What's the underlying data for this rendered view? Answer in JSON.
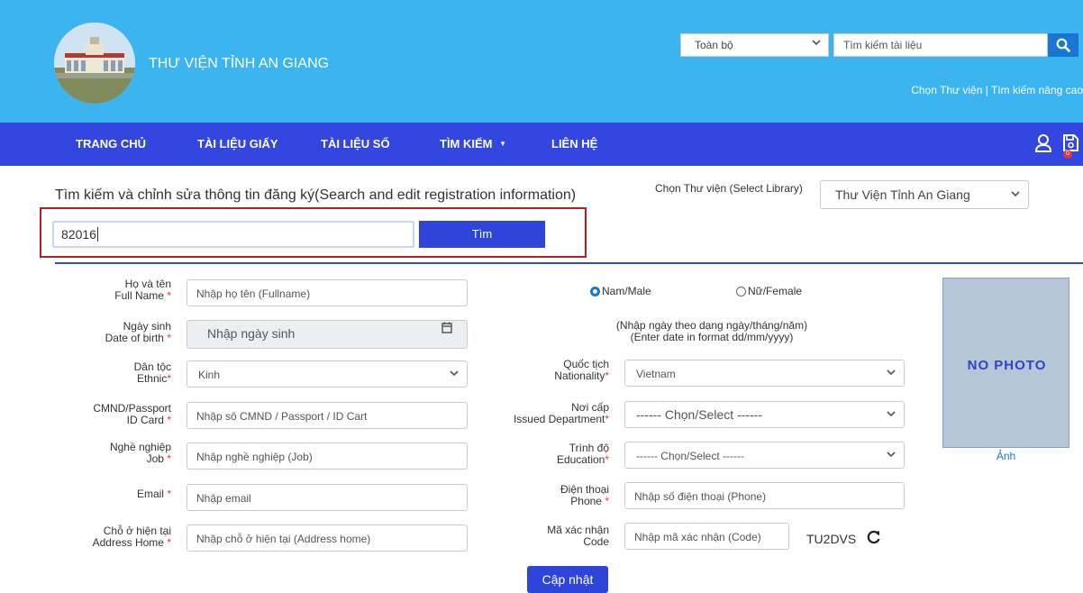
{
  "header": {
    "site_title": "THƯ VIỆN TỈNH AN GIANG",
    "scope_select": "Toàn bộ",
    "search_placeholder": "Tìm kiếm tài liệu",
    "links": "Chọn Thư viện | Tìm kiếm nâng cao",
    "search_icon": "search-icon",
    "primary_color": "#3cb4f0"
  },
  "nav": {
    "items": [
      "TRANG CHỦ",
      "TÀI LIỆU GIẤY",
      "TÀI LIỆU SỐ",
      "TÌM KIẾM",
      "LIÊN HỆ"
    ],
    "dropdown_caret": "▼",
    "cart_count": "0",
    "color": "#3446e0"
  },
  "search_section": {
    "heading": "Tìm kiếm và chỉnh sửa thông tin đăng ký(Search and edit registration information)",
    "library_label": "Chọn Thư viện (Select Library)",
    "library_value": "Thư Viện Tỉnh An Giang",
    "registration_value": "82016",
    "find_button": "Tìm",
    "highlight_color": "#b22222"
  },
  "form": {
    "fullname": {
      "label": "Họ và tên",
      "label_en": "Full Name",
      "placeholder": "Nhập họ tên (Fullname)"
    },
    "dob": {
      "label": "Ngày sinh",
      "label_en": "Date of birth",
      "placeholder": "Nhập ngày sinh"
    },
    "ethnic": {
      "label": "Dân tộc",
      "label_en": "Ethnic",
      "value": "Kinh"
    },
    "id_card": {
      "label": "CMND/Passport",
      "label_en": "ID Card",
      "placeholder": "Nhập sô CMND / Passport / ID Cart"
    },
    "job": {
      "label": "Nghề nghiệp",
      "label_en": "Job",
      "placeholder": "Nhập nghề nghiệp (Job)"
    },
    "email": {
      "label": "Email",
      "placeholder": "Nhập email"
    },
    "address": {
      "label": "Chỗ ở hiện tại",
      "label_en": "Address Home",
      "placeholder": "Nhập chỗ ở hiện tại (Address home)"
    },
    "gender": {
      "male": "Nam/Male",
      "female": "Nữ/Female",
      "selected": "male"
    },
    "date_hint_1": "(Nhập ngày theo dạng ngày/tháng/năm)",
    "date_hint_2": "(Enter date in format dd/mm/yyyy)",
    "nationality": {
      "label": "Quốc tịch",
      "label_en": "Nationality",
      "value": "Vietnam"
    },
    "issued": {
      "label": "Nơi cấp",
      "label_en": "Issued Department",
      "value": "------ Chọn/Select ------"
    },
    "education": {
      "label": "Trình độ",
      "label_en": "Education",
      "value": "------ Chọn/Select ------"
    },
    "phone": {
      "label": "Điện thoại",
      "label_en": "Phone",
      "placeholder": "Nhập số điện thoại (Phone)"
    },
    "code": {
      "label": "Mã xác nhận",
      "label_en": "Code",
      "placeholder": "Nhập mã xác nhận (Code)",
      "captcha": "TU2DVS"
    },
    "photo": {
      "text": "NO PHOTO",
      "link": "Ảnh"
    },
    "required_mark": "*",
    "update_button": "Cập nhật"
  }
}
